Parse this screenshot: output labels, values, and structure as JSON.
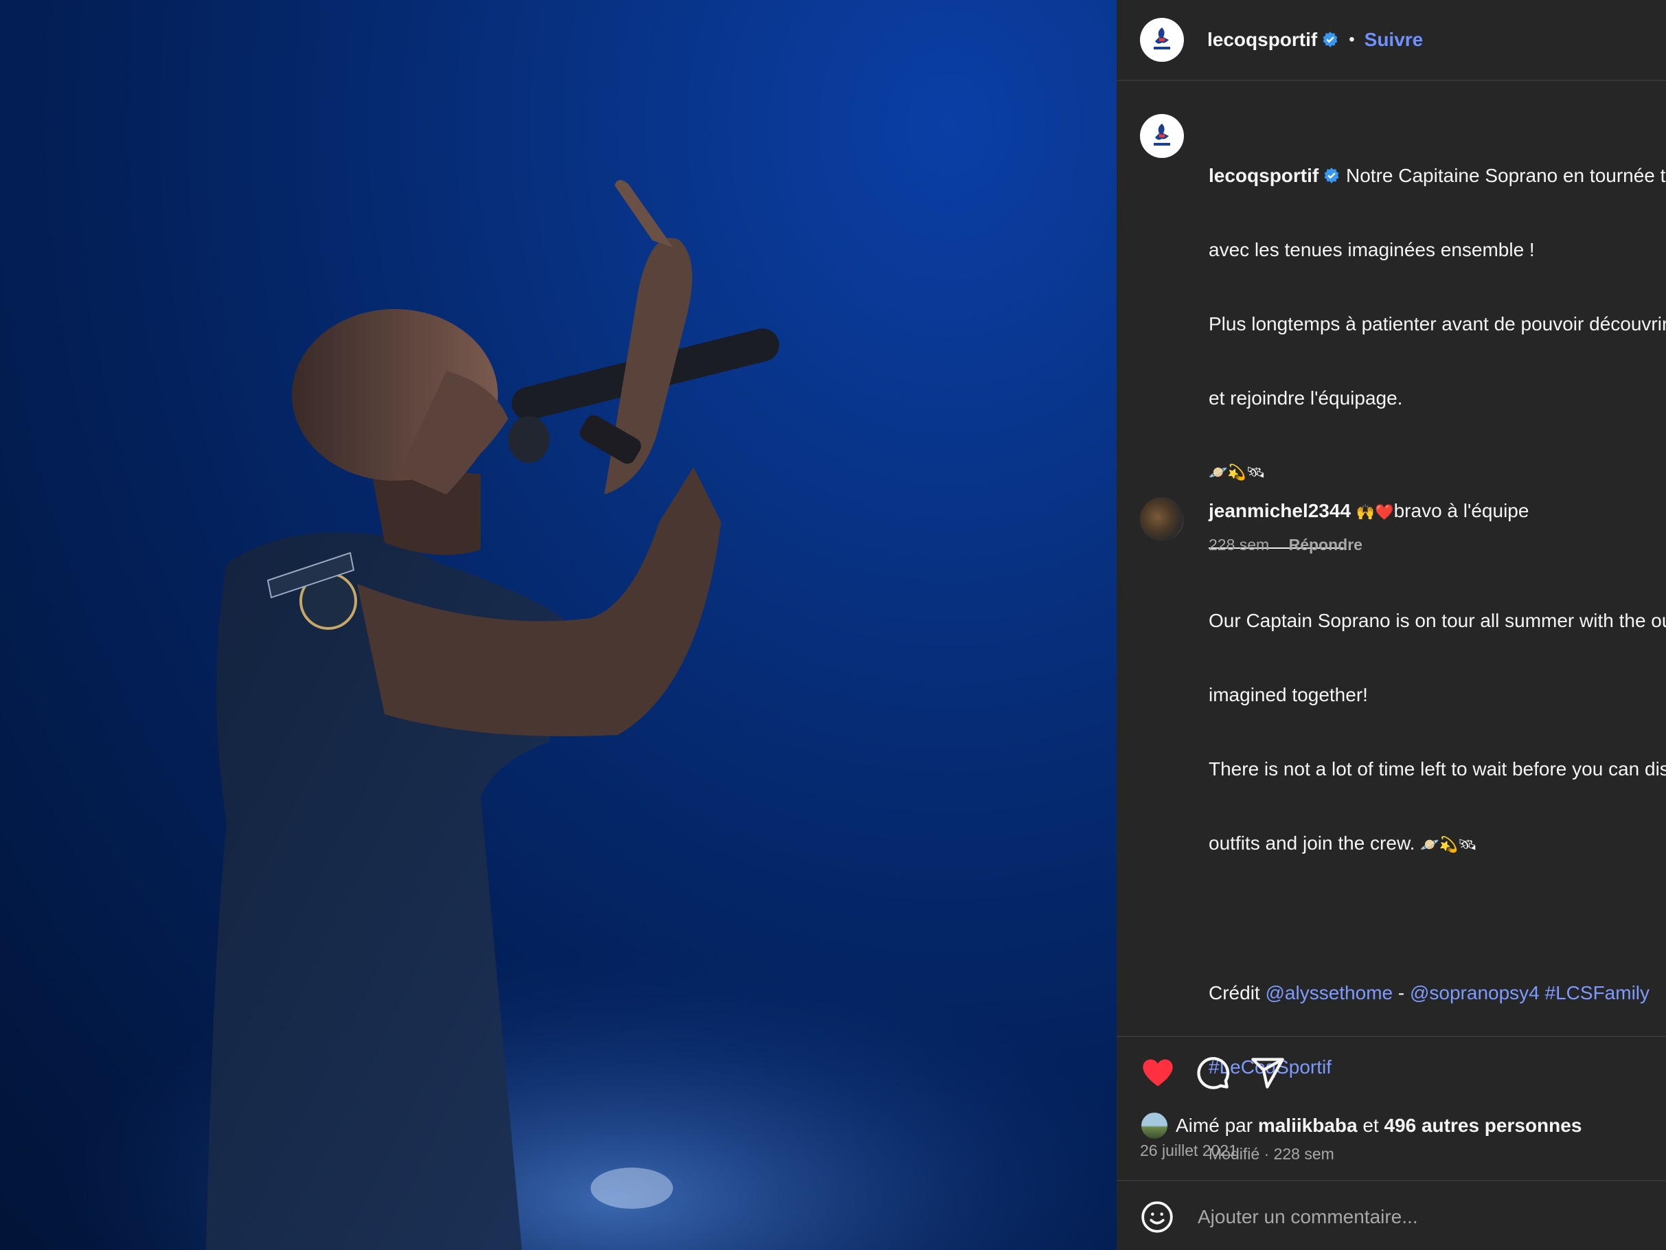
{
  "post": {
    "author": "lecoqsportif",
    "follow_label": "Suivre",
    "separator": "•",
    "photo_alt": "Soprano singing on stage",
    "colors": {
      "accent": "#6f91ff",
      "link": "#7d9bff",
      "like": "#ff3040",
      "panel_bg": "#262626"
    }
  },
  "caption": {
    "author": "lecoqsportif",
    "line_fr_1": "Notre Capitaine Soprano en tournée tout l'été",
    "line_fr_2": "avec les tenues imaginées ensemble !",
    "line_fr_3": "Plus longtemps à patienter avant de pouvoir découvrir les tenues",
    "line_fr_4": "et rejoindre l'équipage.",
    "emojis_1": "🪐💫🛰",
    "divider": "———————",
    "line_en_1": "Our Captain Soprano is on tour all summer with the outfits",
    "line_en_2": "imagined together!",
    "line_en_3": "There is not a lot of time left to wait before you can discover the",
    "line_en_4": "outfits and join the crew.",
    "emojis_2": "🪐💫🛰",
    "credit_label": "Crédit",
    "mention_1": "@alyssethome",
    "dash": "-",
    "mention_2": "@sopranopsy4",
    "hashtag_1": "#LCSFamily",
    "hashtag_2": "#LeCoqSportif",
    "modified": "Modifié · 228 sem"
  },
  "comment": {
    "author": "jeanmichel2344",
    "emojis": "🙌❤️",
    "text": "bravo à l'équipe",
    "age": "228 sem",
    "reply_label": "Répondre"
  },
  "likes": {
    "prefix": "Aimé par",
    "user": "maliikbaba",
    "connector": "et",
    "others": "496 autres personnes",
    "date": "26 juillet 2021"
  },
  "add_comment": {
    "placeholder": "Ajouter un commentaire..."
  },
  "icons": [
    "heart-icon",
    "comment-icon",
    "share-icon",
    "emoji-icon",
    "verified-icon"
  ]
}
